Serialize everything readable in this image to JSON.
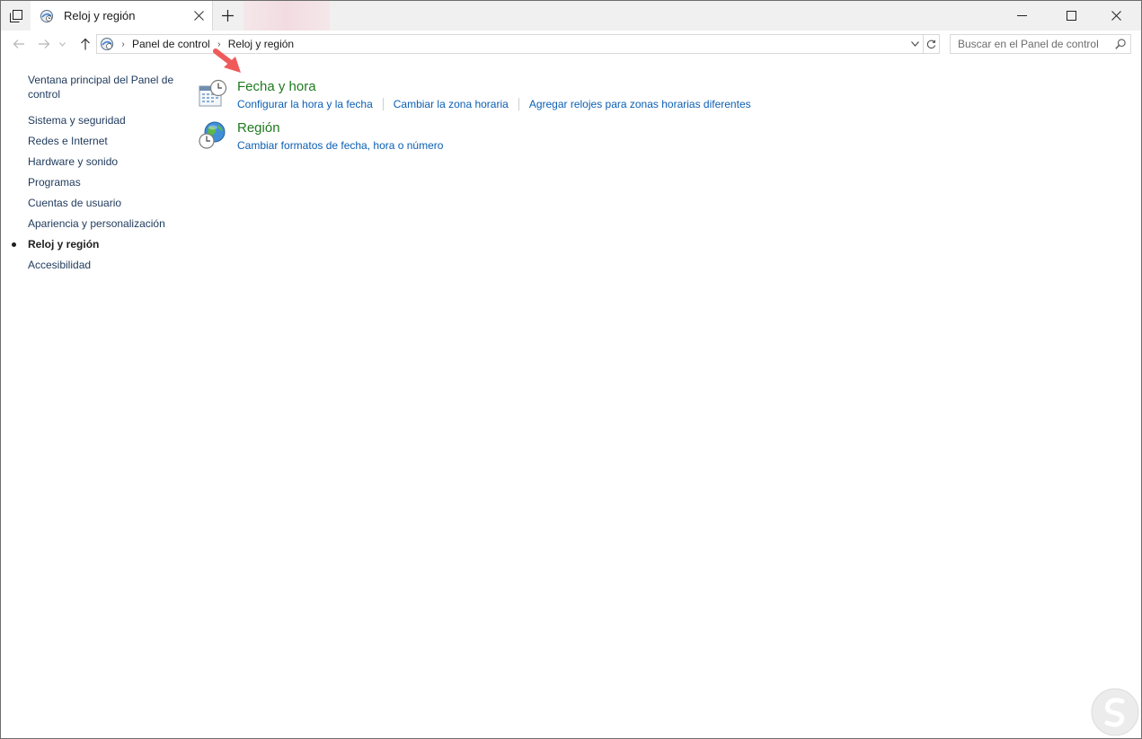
{
  "window": {
    "tab_title": "Reloj y región"
  },
  "address": {
    "breadcrumbs": [
      "Panel de control",
      "Reloj y región"
    ],
    "search_placeholder": "Buscar en el Panel de control"
  },
  "sidebar": {
    "home_link": "Ventana principal del Panel de control",
    "items": [
      {
        "label": "Sistema y seguridad"
      },
      {
        "label": "Redes e Internet"
      },
      {
        "label": "Hardware y sonido"
      },
      {
        "label": "Programas"
      },
      {
        "label": "Cuentas de usuario"
      },
      {
        "label": "Apariencia y personalización"
      },
      {
        "label": "Reloj y región",
        "current": true
      },
      {
        "label": "Accesibilidad"
      }
    ]
  },
  "categories": [
    {
      "title": "Fecha y hora",
      "icon": "calendar-clock-icon",
      "links": [
        "Configurar la hora y la fecha",
        "Cambiar la zona horaria",
        "Agregar relojes para zonas horarias diferentes"
      ]
    },
    {
      "title": "Región",
      "icon": "globe-clock-icon",
      "links": [
        "Cambiar formatos de fecha, hora o número"
      ]
    }
  ],
  "colors": {
    "category_title": "#1e7a1e",
    "task_link": "#0b5fb4",
    "sidebar_link": "#1e395b",
    "annotation_arrow": "#ef5b5b"
  }
}
